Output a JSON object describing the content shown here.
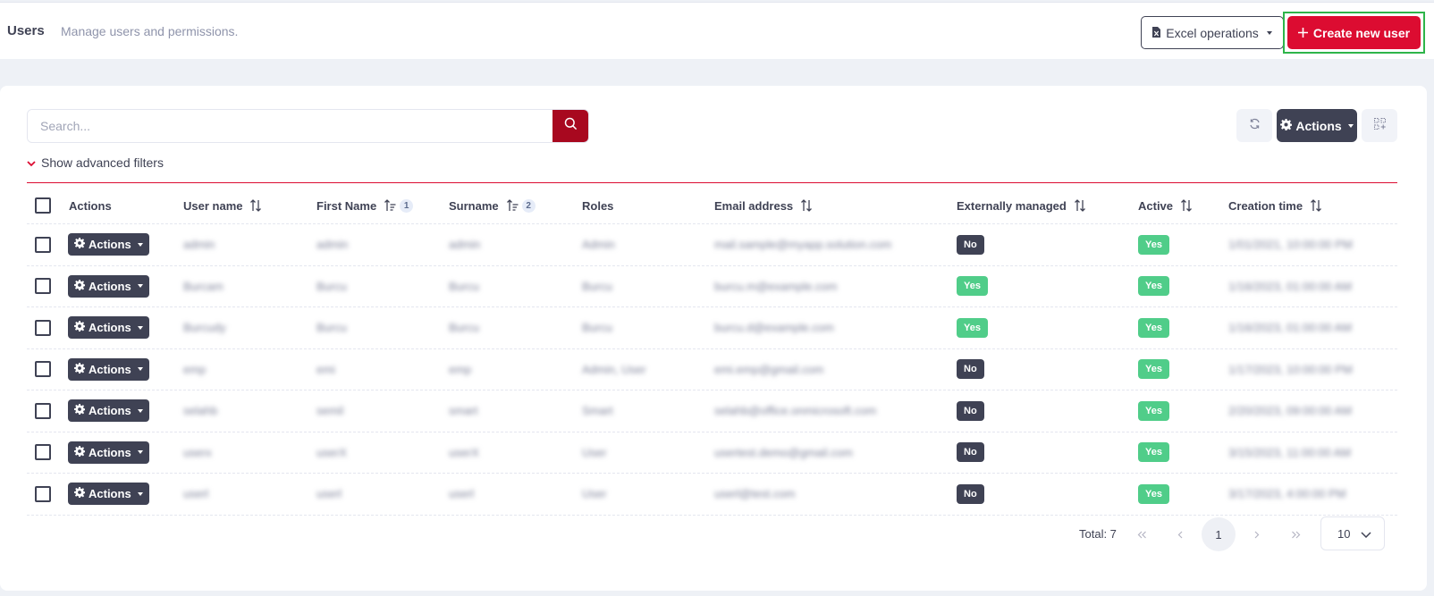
{
  "header": {
    "title": "Users",
    "subtitle": "Manage users and permissions.",
    "excel_label": "Excel operations",
    "create_label": "Create new user"
  },
  "toolbar": {
    "search_placeholder": "Search...",
    "actions_label": "Actions",
    "advanced_filters_label": "Show advanced filters"
  },
  "table": {
    "columns": {
      "actions": "Actions",
      "user_name": "User name",
      "first_name": "First Name",
      "first_name_sort_order": "1",
      "surname": "Surname",
      "surname_sort_order": "2",
      "roles": "Roles",
      "email": "Email address",
      "externally_managed": "Externally managed",
      "active": "Active",
      "creation_time": "Creation time"
    },
    "row_action_label": "Actions",
    "rows": [
      {
        "user_name": "admin",
        "first_name": "admin",
        "surname": "admin",
        "roles": "Admin",
        "email": "mail.sample@myapp.solution.com",
        "externally_managed": "No",
        "active": "Yes",
        "creation_time": "1/01/2021, 10:00:00 PM"
      },
      {
        "user_name": "Burcam",
        "first_name": "Burcu",
        "surname": "Burcu",
        "roles": "Burcu",
        "email": "burcu.m@example.com",
        "externally_managed": "Yes",
        "active": "Yes",
        "creation_time": "1/16/2023, 01:00:00 AM"
      },
      {
        "user_name": "Burcudy",
        "first_name": "Burcu",
        "surname": "Burcu",
        "roles": "Burcu",
        "email": "burcu.d@example.com",
        "externally_managed": "Yes",
        "active": "Yes",
        "creation_time": "1/16/2023, 01:00:00 AM"
      },
      {
        "user_name": "emp",
        "first_name": "emi",
        "surname": "emp",
        "roles": "Admin, User",
        "email": "emi.emp@gmail.com",
        "externally_managed": "No",
        "active": "Yes",
        "creation_time": "1/17/2023, 10:00:00 PM"
      },
      {
        "user_name": "selahb",
        "first_name": "semil",
        "surname": "smart",
        "roles": "Smart",
        "email": "selahb@office.onmicrosoft.com",
        "externally_managed": "No",
        "active": "Yes",
        "creation_time": "2/20/2023, 09:00:00 AM"
      },
      {
        "user_name": "userx",
        "first_name": "userX",
        "surname": "userX",
        "roles": "User",
        "email": "usertest.demo@gmail.com",
        "externally_managed": "No",
        "active": "Yes",
        "creation_time": "3/15/2023, 11:00:00 AM"
      },
      {
        "user_name": "userl",
        "first_name": "userl",
        "surname": "userl",
        "roles": "User",
        "email": "userl@test.com",
        "externally_managed": "No",
        "active": "Yes",
        "creation_time": "3/17/2023, 4:00:00 PM"
      }
    ]
  },
  "pagination": {
    "total_label": "Total: 7",
    "current_page": "1",
    "page_size": "10"
  },
  "colors": {
    "primary_red": "#dc0c31",
    "dark": "#3f4254",
    "success": "#50cd89",
    "highlight_green": "#2eb54a"
  },
  "icons": {
    "excel": "file-excel-icon",
    "plus": "plus-icon",
    "search": "search-icon",
    "refresh": "refresh-icon",
    "gear": "gear-icon",
    "grid": "grid-icon",
    "chevron": "chevron-down-icon",
    "sort": "sort-icon"
  }
}
